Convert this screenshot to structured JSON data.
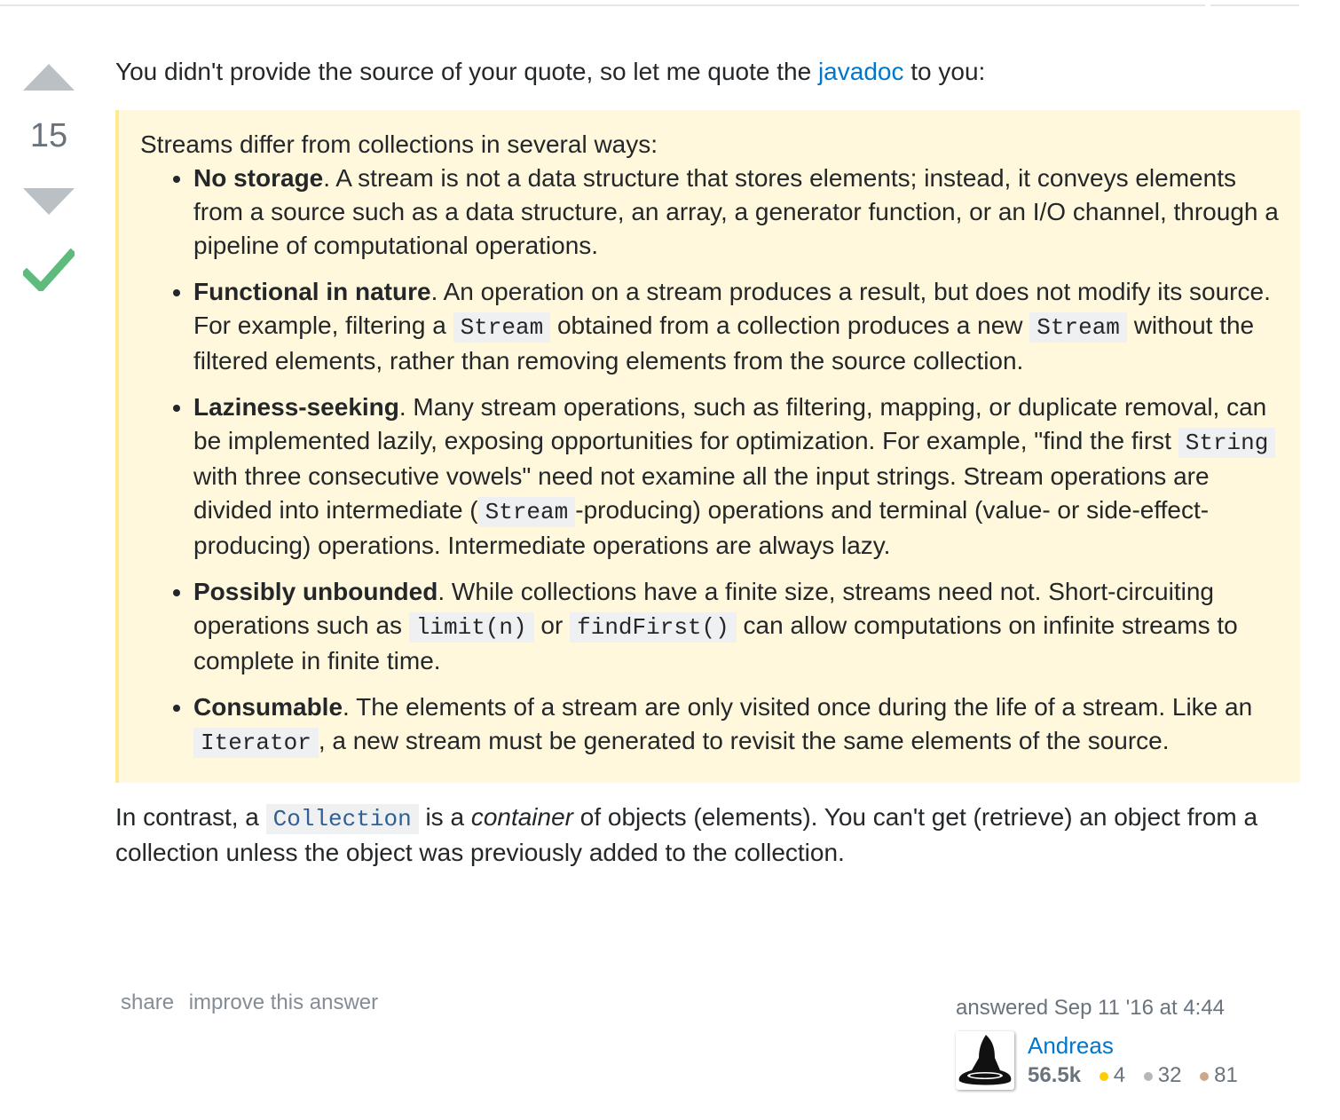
{
  "vote": {
    "count": "15"
  },
  "intro": {
    "before": "You didn't provide the source of your quote, so let me quote the ",
    "link": "javadoc",
    "after": " to you:"
  },
  "quote": {
    "lead": "Streams differ from collections in several ways:",
    "items": [
      {
        "title": "No storage",
        "text": ". A stream is not a data structure that stores elements; instead, it conveys elements from a source such as a data structure, an array, a generator function, or an I/O channel, through a pipeline of computational operations."
      },
      {
        "title": "Functional in nature",
        "t1": ". An operation on a stream produces a result, but does not modify its source. For example, filtering a ",
        "c1": "Stream",
        "t2": " obtained from a collection produces a new ",
        "c2": "Stream",
        "t3": " without the filtered elements, rather than removing elements from the source collection."
      },
      {
        "title": "Laziness-seeking",
        "t1": ". Many stream operations, such as filtering, mapping, or duplicate removal, can be implemented lazily, exposing opportunities for optimization. For example, \"find the first ",
        "c1": "String",
        "t2": " with three consecutive vowels\" need not examine all the input strings. Stream operations are divided into intermediate (",
        "c2": "Stream",
        "t3": "-producing) operations and terminal (value- or side-effect-producing) operations. Intermediate operations are always lazy."
      },
      {
        "title": "Possibly unbounded",
        "t1": ". While collections have a finite size, streams need not. Short-circuiting operations such as ",
        "c1": "limit(n)",
        "t2": " or ",
        "c2": "findFirst()",
        "t3": " can allow computations on infinite streams to complete in finite time."
      },
      {
        "title": "Consumable",
        "t1": ". The elements of a stream are only visited once during the life of a stream. Like an ",
        "c1": "Iterator",
        "t2": ", a new stream must be generated to revisit the same elements of the source."
      }
    ]
  },
  "outro": {
    "t1": "In contrast, a ",
    "c1": "Collection",
    "t2": " is a ",
    "em": "container",
    "t3": " of objects (elements). You can't get (retrieve) an object from a collection unless the object was previously added to the collection."
  },
  "menu": {
    "share": "share",
    "improve": "improve this answer"
  },
  "user": {
    "answered": "answered Sep 11 '16 at 4:44",
    "name": "Andreas",
    "reputation": "56.5k",
    "gold": "4",
    "silver": "32",
    "bronze": "81"
  },
  "colors": {
    "gold": "#ffcc01",
    "silver": "#b4b8bc",
    "bronze": "#d1a684",
    "link": "#0077cc",
    "accepted": "#5eba7d"
  }
}
